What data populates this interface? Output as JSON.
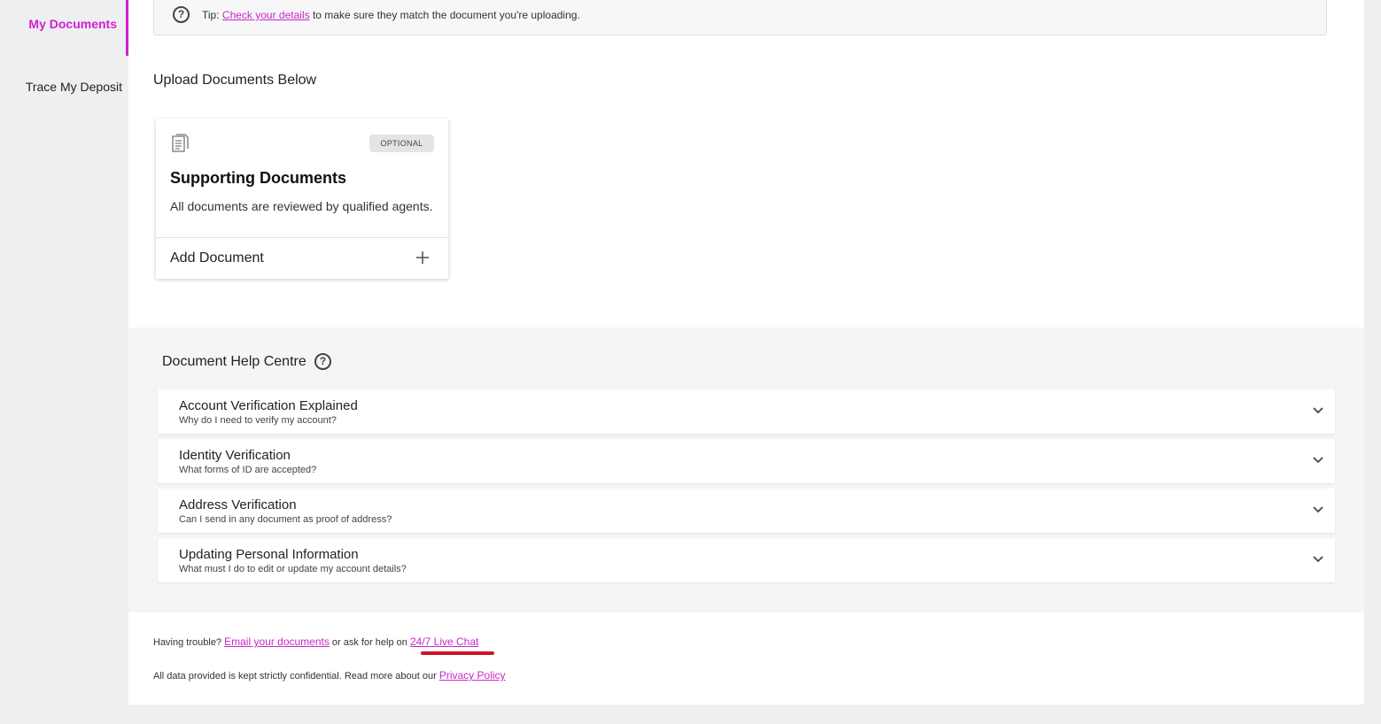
{
  "sidebar": {
    "items": [
      {
        "label": "My Documents"
      },
      {
        "label": "Trace My Deposit"
      }
    ]
  },
  "tip": {
    "prefix": "Tip:",
    "link": "Check your details",
    "suffix": "to make sure they match the document you're uploading."
  },
  "upload": {
    "heading": "Upload Documents Below",
    "card": {
      "badge": "OPTIONAL",
      "title": "Supporting Documents",
      "description": "All documents are reviewed by qualified agents.",
      "add_label": "Add Document"
    }
  },
  "help": {
    "heading": "Document Help Centre",
    "items": [
      {
        "title": "Account Verification Explained",
        "subtitle": "Why do I need to verify my account?"
      },
      {
        "title": "Identity Verification",
        "subtitle": "What forms of ID are accepted?"
      },
      {
        "title": "Address Verification",
        "subtitle": "Can I send in any document as proof of address?"
      },
      {
        "title": "Updating Personal Information",
        "subtitle": "What must I do to edit or update my account details?"
      }
    ]
  },
  "footer": {
    "trouble_prefix": "Having trouble?",
    "email_link": "Email your documents",
    "trouble_middle": "or ask for help on",
    "chat_link": "24/7 Live Chat",
    "confidential_text": "All data provided is kept strictly confidential. Read more about our",
    "privacy_link": "Privacy Policy"
  },
  "colors": {
    "accent": "#d21fd2",
    "link": "#c729c7",
    "annotation": "#d0132a"
  },
  "icons": [
    "help-circle-icon",
    "document-icon",
    "plus-icon",
    "chevron-down-icon"
  ]
}
